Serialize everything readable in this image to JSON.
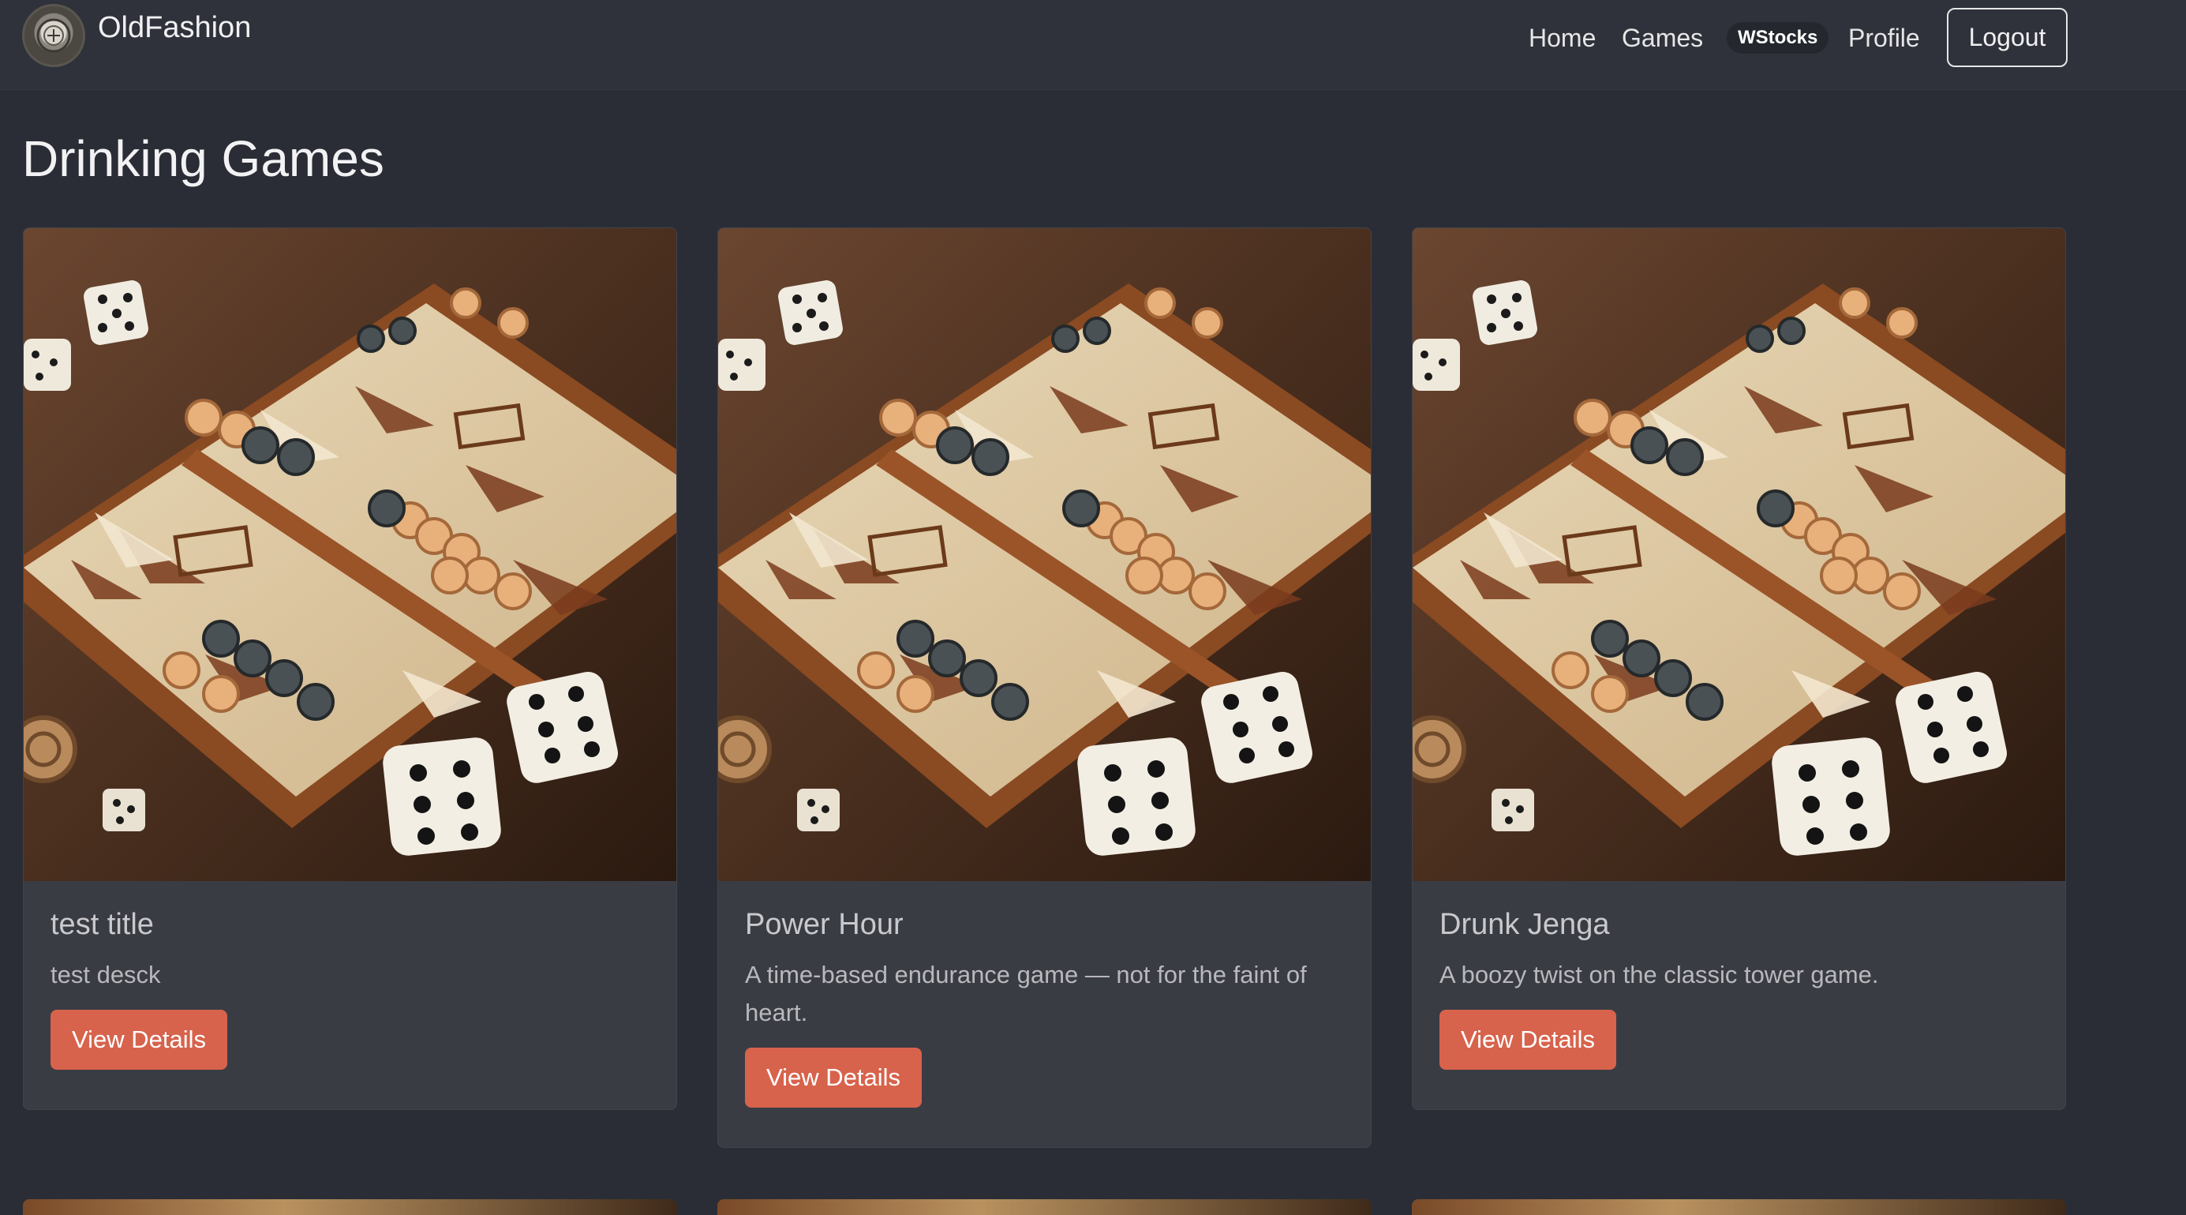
{
  "navbar": {
    "brand_name": "OldFashion",
    "links": [
      "Home",
      "Games"
    ],
    "wstocks_label": "WStocks",
    "profile_label": "Profile",
    "logout_label": "Logout"
  },
  "page": {
    "title": "Drinking Games"
  },
  "cards": [
    {
      "title": "test title",
      "description": "test desck",
      "button_label": "View Details",
      "image_icon": "backgammon-board-image"
    },
    {
      "title": "Power Hour",
      "description": "A time-based endurance game — not for the faint of heart.",
      "button_label": "View Details",
      "image_icon": "backgammon-board-image"
    },
    {
      "title": "Drunk Jenga",
      "description": "A boozy twist on the classic tower game.",
      "button_label": "View Details",
      "image_icon": "backgammon-board-image"
    }
  ],
  "colors": {
    "background": "#2a2d35",
    "navbar": "#2f323a",
    "card": "#3a3c44",
    "accent_button": "#d7634c"
  }
}
